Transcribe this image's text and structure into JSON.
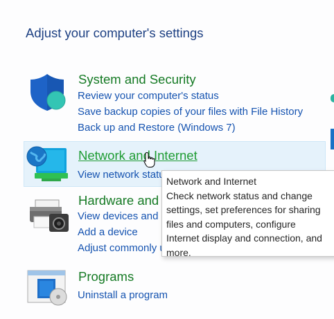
{
  "page": {
    "heading": "Adjust your computer's settings"
  },
  "categories": [
    {
      "title": "System and Security",
      "icon": "shield-icon",
      "links": [
        "Review your computer's status",
        "Save backup copies of your files with File History",
        "Back up and Restore (Windows 7)"
      ]
    },
    {
      "title": "Network and Internet",
      "icon": "globe-monitor-icon",
      "links": [
        "View network status and tasks"
      ]
    },
    {
      "title": "Hardware and Sound",
      "icon": "printer-camera-icon",
      "links": [
        "View devices and printers",
        "Add a device",
        "Adjust commonly used mobility settings"
      ]
    },
    {
      "title": "Programs",
      "icon": "programs-icon",
      "links": [
        "Uninstall a program"
      ]
    }
  ],
  "tooltip": {
    "lines": [
      "Network and Internet",
      "Check network status and change",
      "settings, set preferences for sharing",
      "files and computers, configure",
      "Internet display and connection, and",
      "more."
    ]
  },
  "colors": {
    "title_green": "#157a24",
    "link_blue": "#1553b0",
    "heading_blue": "#1c3f82",
    "hover_bg": "#e5f2fb"
  }
}
